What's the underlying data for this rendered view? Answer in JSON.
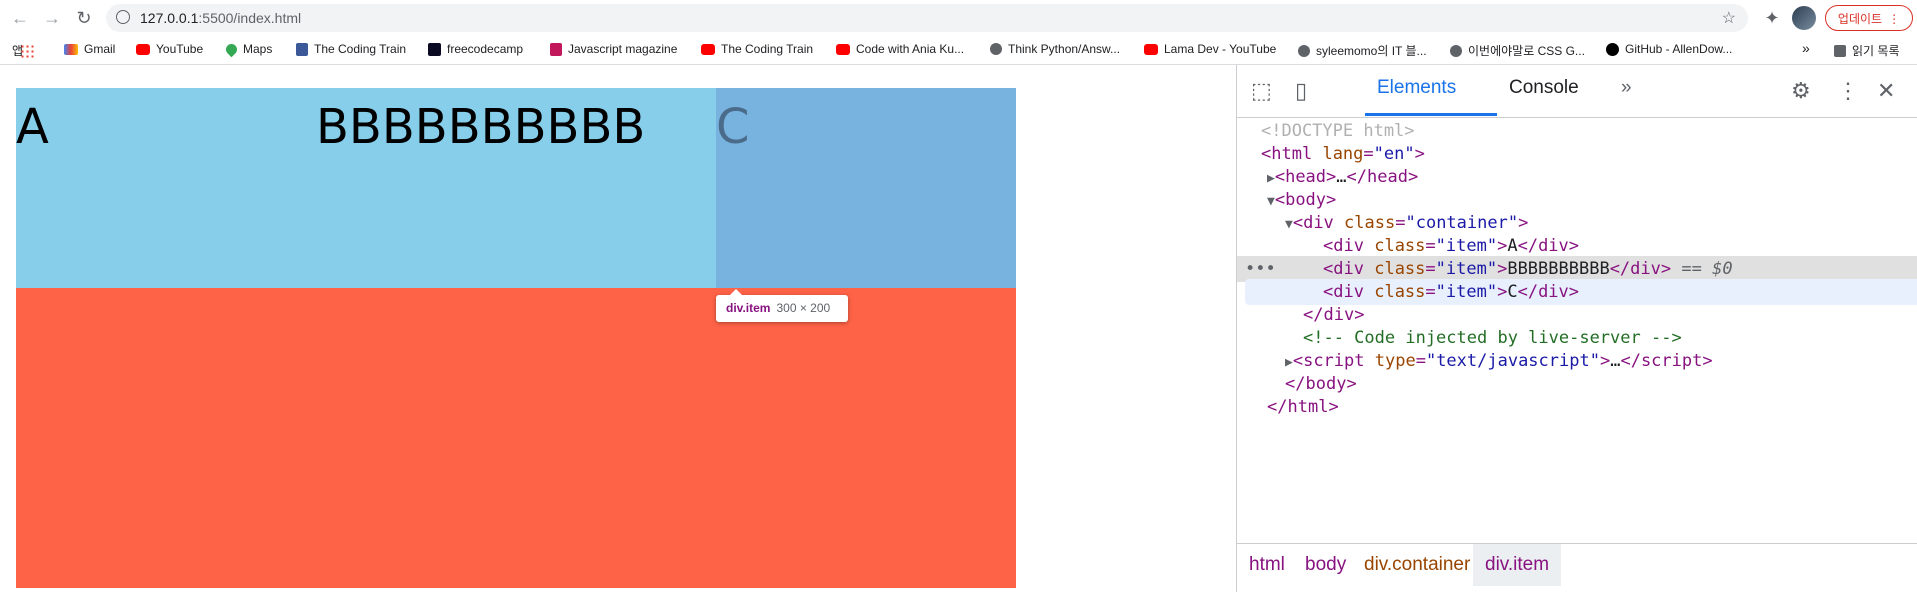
{
  "browser": {
    "url_host": "127.0.0.1",
    "url_rest": ":5500/index.html",
    "update_label": "업데이트",
    "bookmarks": [
      {
        "label": "앱",
        "icon": "apps-icon"
      },
      {
        "label": "Gmail",
        "icon": "gmail-icon"
      },
      {
        "label": "YouTube",
        "icon": "youtube-icon"
      },
      {
        "label": "Maps",
        "icon": "maps-icon"
      },
      {
        "label": "The Coding Train",
        "icon": "coding-train-icon"
      },
      {
        "label": "freecodecamp",
        "icon": "freecodecamp-icon"
      },
      {
        "label": "Javascript magazine",
        "icon": "js-magazine-icon"
      },
      {
        "label": "The Coding Train",
        "icon": "youtube-icon"
      },
      {
        "label": "Code with Ania Ku...",
        "icon": "youtube-icon"
      },
      {
        "label": "Think Python/Answ...",
        "icon": "book-icon"
      },
      {
        "label": "Lama Dev - YouTube",
        "icon": "youtube-icon"
      },
      {
        "label": "syleemomo의 IT 블...",
        "icon": "globe-icon"
      },
      {
        "label": "이번에야말로 CSS G...",
        "icon": "github-cat-icon"
      },
      {
        "label": "GitHub - AllenDow...",
        "icon": "github-icon"
      }
    ],
    "reading_list": "읽기 목록",
    "overflow": "»"
  },
  "page": {
    "items": [
      "A",
      "BBBBBBBBBB",
      "C"
    ],
    "tooltip": {
      "tag": "div.item",
      "dims": "300 × 200"
    }
  },
  "devtools": {
    "tabs": [
      "Elements",
      "Console"
    ],
    "more_tabs": "»",
    "dom": {
      "doctype": "<!DOCTYPE html>",
      "html_open_tag": "html",
      "lang_attr": "lang",
      "lang_val": "\"en\"",
      "head": "head",
      "body": "body",
      "div": "div",
      "class_attr": "class",
      "container_val": "\"container\"",
      "item_val": "\"item\"",
      "item_texts": [
        "A",
        "BBBBBBBBBB",
        "C"
      ],
      "selected_marker": "== $0",
      "comment": "<!-- Code injected by live-server -->",
      "script": "script",
      "type_attr": "type",
      "type_val": "\"text/javascript\"",
      "ellipsis": "…"
    },
    "breadcrumbs": [
      "html",
      "body",
      "div.container",
      "div.item"
    ]
  }
}
